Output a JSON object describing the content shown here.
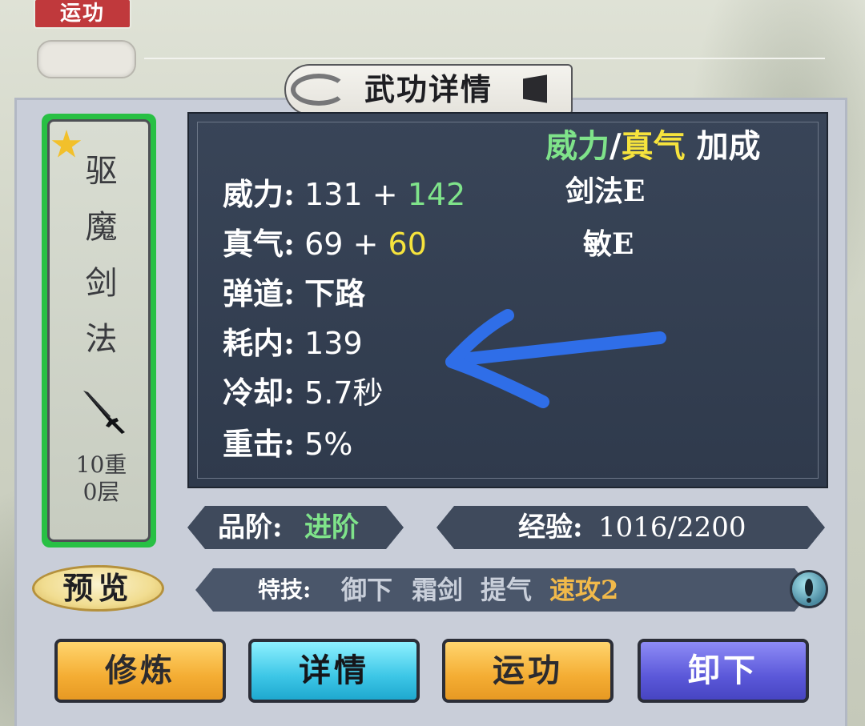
{
  "top": {
    "tag_label": "运功"
  },
  "title": "武功详情",
  "skill_card": {
    "name_chars": [
      "驱",
      "魔",
      "剑",
      "法"
    ],
    "level_line1": "10重",
    "level_line2": "0层",
    "icon": "sword-icon"
  },
  "stats": {
    "power_label": "威力:",
    "power_base": "131",
    "plus": "+",
    "power_bonus": "142",
    "qi_label": "真气:",
    "qi_base": "69",
    "qi_bonus": "60",
    "trajectory_label": "弹道:",
    "trajectory_value": "下路",
    "cost_label": "耗内:",
    "cost_value": "139",
    "cooldown_label": "冷却:",
    "cooldown_value": "5.7秒",
    "crit_label": "重击:",
    "crit_value": "5%"
  },
  "bonus": {
    "header_power": "威力",
    "slash": "/",
    "header_qi": "真气",
    "header_suffix": "加成",
    "items": [
      "剑法E",
      "敏E"
    ]
  },
  "grade": {
    "label": "品阶:",
    "value": "进阶"
  },
  "experience": {
    "label": "经验:",
    "value": "1016/2200"
  },
  "special": {
    "label": "特技:",
    "items": [
      "御下",
      "霜剑",
      "提气"
    ],
    "highlight": "速攻2"
  },
  "preview_label": "预览",
  "buttons": {
    "train": "修炼",
    "details": "详情",
    "activate": "运功",
    "unequip": "卸下"
  },
  "colors": {
    "green": "#7fe38a",
    "yellow": "#f6e33d",
    "orange_button": "#f4ad33",
    "cyan_button": "#3cc6e6",
    "purple_button": "#5b58d9",
    "card_border": "#28c044"
  }
}
